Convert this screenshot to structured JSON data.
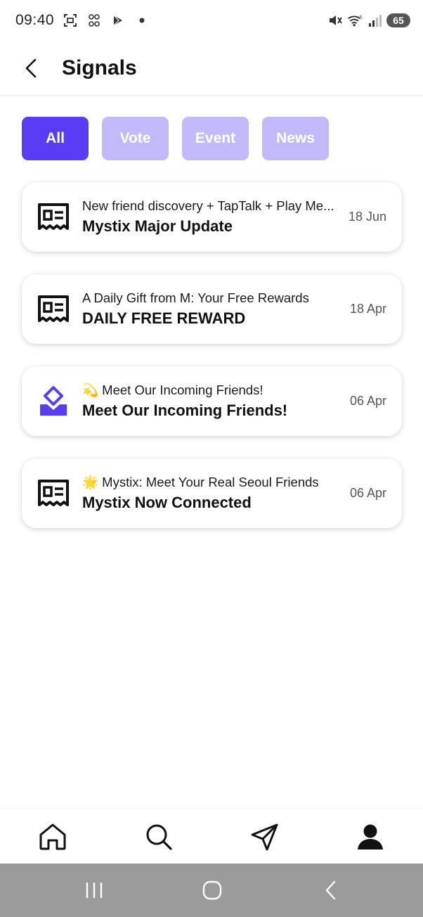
{
  "status_bar": {
    "time": "09:40",
    "battery": "65",
    "icons": [
      "screenshot-icon",
      "qr-scan-icon",
      "play-store-icon",
      "dot-icon",
      "mute-icon",
      "wifi-icon",
      "signal-icon",
      "battery-icon"
    ]
  },
  "header": {
    "title": "Signals",
    "back_icon": "chevron-left-icon"
  },
  "filters": [
    {
      "label": "All",
      "active": true
    },
    {
      "label": "Vote",
      "active": false
    },
    {
      "label": "Event",
      "active": false
    },
    {
      "label": "News",
      "active": false
    }
  ],
  "cards": [
    {
      "icon": "newspaper-icon",
      "subtitle": "New friend discovery + TapTalk + Play Me...",
      "title": "Mystix Major Update",
      "date": "18 Jun"
    },
    {
      "icon": "newspaper-icon",
      "subtitle": "A Daily Gift from M: Your Free Rewards",
      "title": "DAILY FREE REWARD",
      "date": "18 Apr"
    },
    {
      "icon": "ballot-box-icon",
      "subtitle": "💫 Meet Our Incoming Friends!",
      "title": "Meet Our Incoming Friends!",
      "date": "06 Apr"
    },
    {
      "icon": "newspaper-icon",
      "subtitle": "🌟 Mystix: Meet Your Real Seoul Friends",
      "title": "Mystix Now Connected",
      "date": "06 Apr"
    }
  ],
  "bottom_nav": [
    "home-icon",
    "search-icon",
    "send-icon",
    "profile-icon"
  ],
  "system_nav": [
    "recent-apps-icon",
    "home-button-icon",
    "back-icon"
  ],
  "colors": {
    "accent": "#5b3cf5",
    "accent_light": "#c2b9fb",
    "system_nav_bg": "#9b9b9b"
  }
}
